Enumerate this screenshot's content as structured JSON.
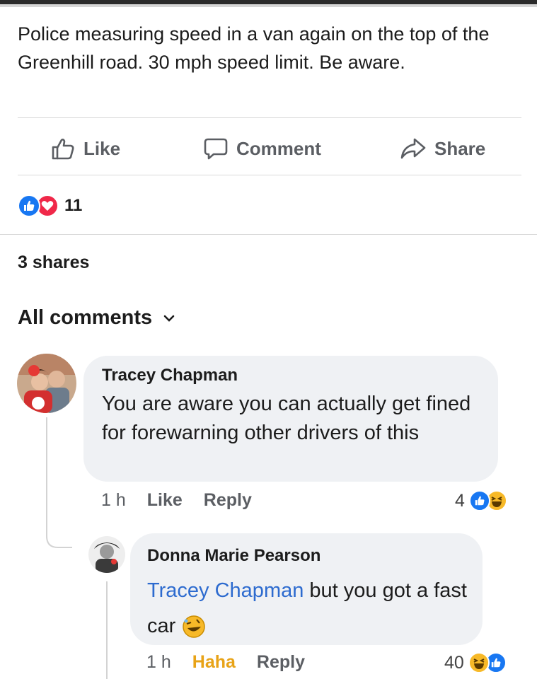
{
  "post": {
    "text": "Police measuring speed in a van again on the top of the Greenhill road. 30 mph speed limit. Be aware."
  },
  "actions": {
    "like": "Like",
    "comment": "Comment",
    "share": "Share"
  },
  "reactions": {
    "count": "11"
  },
  "shares": "3 shares",
  "comments_header": "All comments",
  "comments": [
    {
      "author": "Tracey Chapman",
      "text": "You are aware you can actually get fined for forewarning other drivers of this",
      "time": "1 h",
      "like_label": "Like",
      "reply_label": "Reply",
      "reaction_count": "4"
    }
  ],
  "reply": {
    "author": "Donna Marie Pearson",
    "mention": "Tracey Chapman",
    "text": " but you got a fast car",
    "time": "1 h",
    "reaction_label": "Haha",
    "reply_label": "Reply",
    "reaction_count": "40"
  },
  "colors": {
    "like_blue": "#1877f2",
    "love_red": "#f02849",
    "haha_yellow": "#f7b928",
    "mention_blue": "#2d6bcf"
  }
}
